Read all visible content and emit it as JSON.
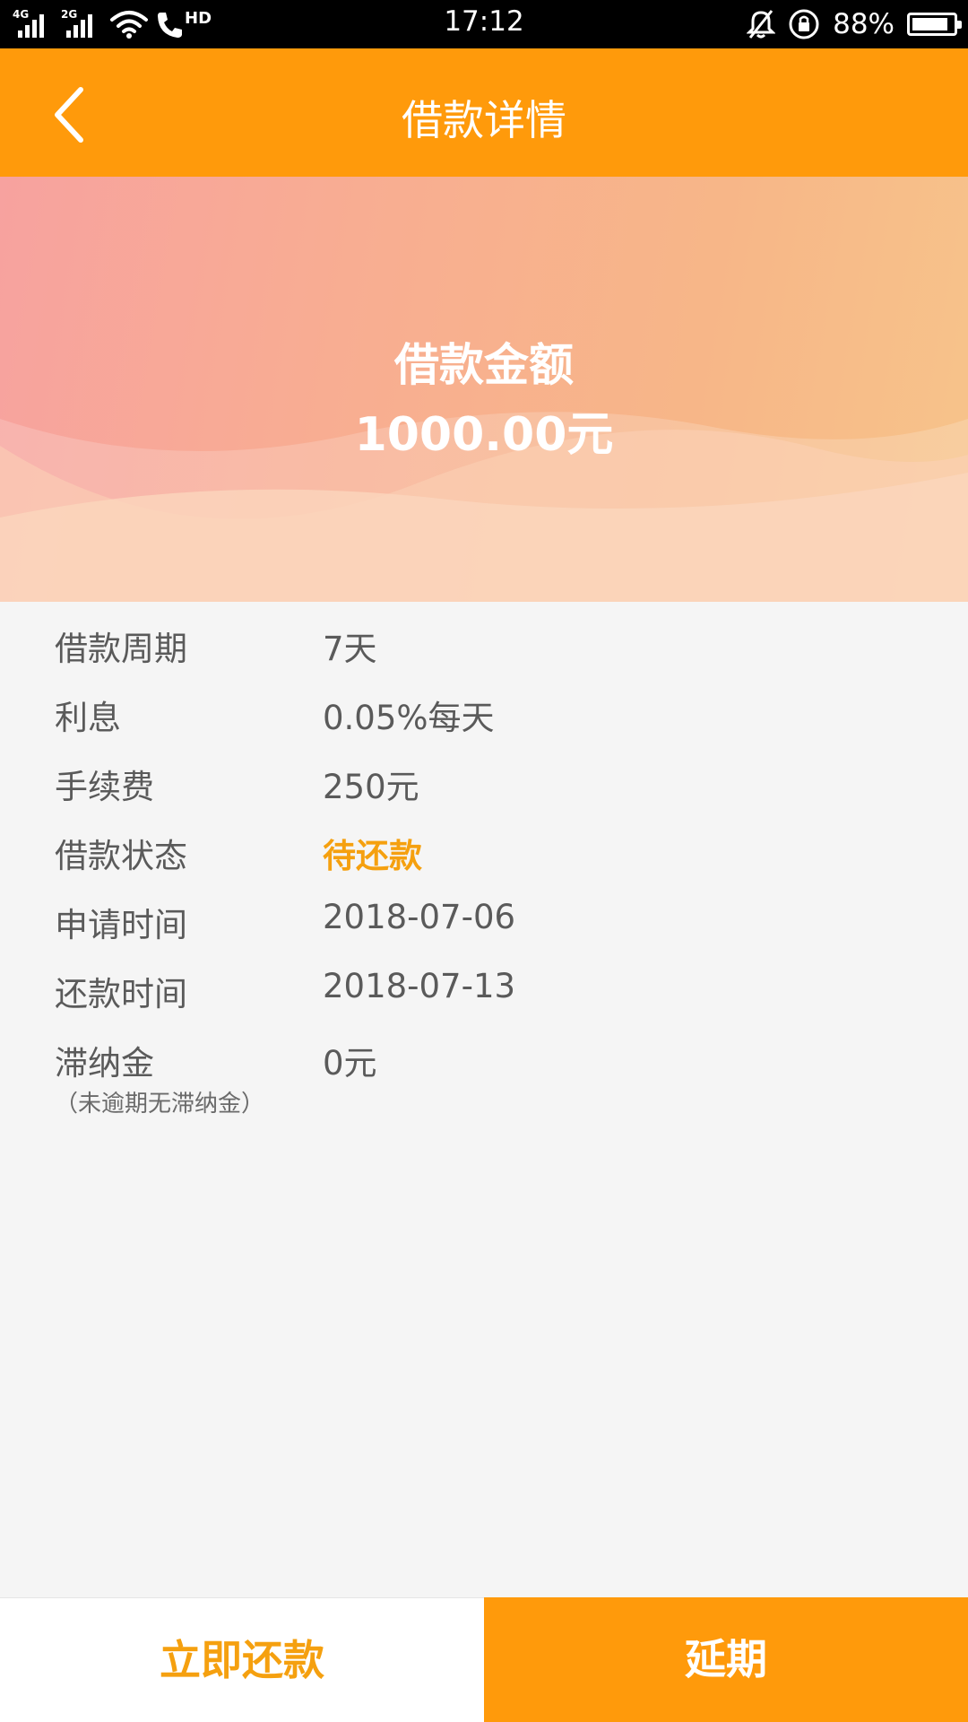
{
  "status_bar": {
    "signal1_label": "4G",
    "signal2_label": "2G",
    "hd_label": "HD",
    "time": "17:12",
    "battery_percent": "88%",
    "battery_level": 0.88,
    "icons": [
      "signal-icon",
      "wifi-icon",
      "call-icon",
      "bell-muted-icon",
      "rotation-lock-icon",
      "battery-icon"
    ]
  },
  "header": {
    "title": "借款详情",
    "back_icon": "chevron-left-icon"
  },
  "hero": {
    "label": "借款金额",
    "amount": "1000.00元"
  },
  "details": {
    "rows": [
      {
        "label": "借款周期",
        "value": "7天"
      },
      {
        "label": "利息",
        "value": "0.05%每天"
      },
      {
        "label": "手续费",
        "value": "250元"
      },
      {
        "label": "借款状态",
        "value": "待还款"
      },
      {
        "label": "申请时间",
        "value": "2018-07-06"
      },
      {
        "label": "还款时间",
        "value": "2018-07-13"
      },
      {
        "label": "滞纳金",
        "value": "0元"
      }
    ],
    "late_fee_note": "（未逾期无滞纳金）"
  },
  "actions": {
    "repay_label": "立即还款",
    "extend_label": "延期"
  },
  "colors": {
    "accent": "#ff9a0b",
    "status_text": "#f5a00f",
    "text": "#5a5a5a",
    "background": "#f5f5f5"
  }
}
